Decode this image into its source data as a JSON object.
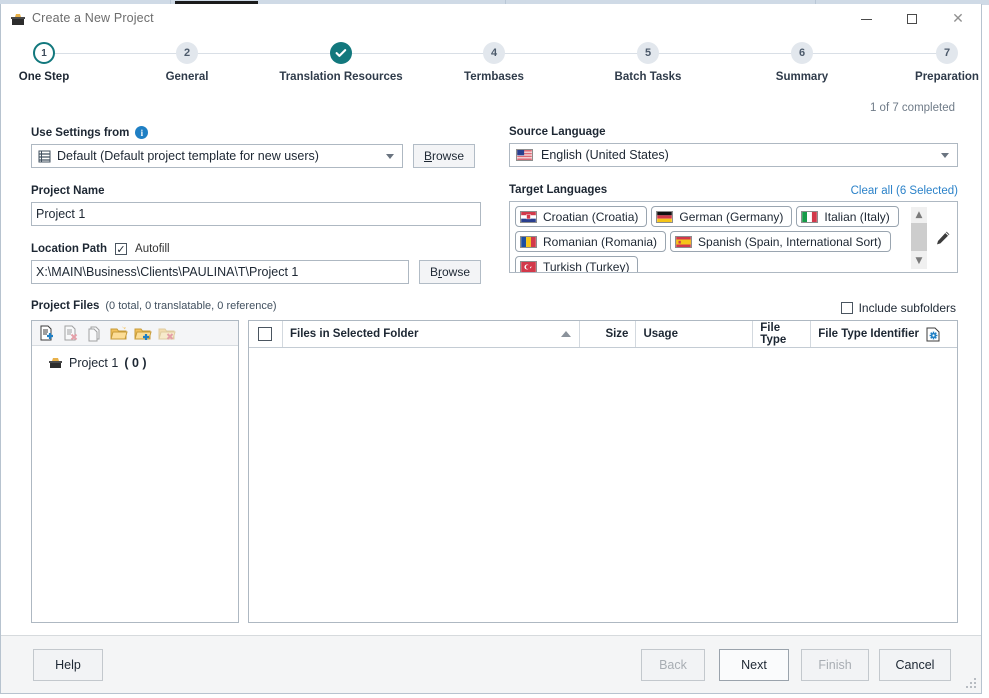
{
  "window": {
    "title": "Create a New Project",
    "icon": "project-box-icon",
    "controls": {
      "minimize": "Minimize",
      "maximize": "Maximize",
      "close": "Close"
    }
  },
  "stepper": {
    "completed_note": "1 of 7 completed",
    "steps": [
      {
        "num": "1",
        "label": "One Step",
        "state": "current"
      },
      {
        "num": "2",
        "label": "General",
        "state": "pending"
      },
      {
        "num": "3",
        "label": "Translation Resources",
        "state": "done"
      },
      {
        "num": "4",
        "label": "Termbases",
        "state": "pending"
      },
      {
        "num": "5",
        "label": "Batch Tasks",
        "state": "pending"
      },
      {
        "num": "6",
        "label": "Summary",
        "state": "pending"
      },
      {
        "num": "7",
        "label": "Preparation",
        "state": "pending"
      }
    ]
  },
  "form": {
    "use_settings": {
      "label": "Use Settings from",
      "info_glyph": "i",
      "value": "Default (Default project template for new users)",
      "browse": "Browse",
      "browse_accel": "B"
    },
    "project_name": {
      "label": "Project Name",
      "value": "Project 1",
      "placeholder": "Project Name"
    },
    "location_path": {
      "label": "Location Path",
      "autofill_label": "Autofill",
      "autofill_checked": true,
      "value": "X:\\MAIN\\Business\\Clients\\PAULINA\\T\\Project 1",
      "browse": "Browse",
      "browse_accel": "r"
    },
    "source_language": {
      "label": "Source Language",
      "value": "English (United States)",
      "flag": "flag-us"
    },
    "target_languages": {
      "label": "Target Languages",
      "clear_all": "Clear all (6 Selected)",
      "edit_icon": "pencil-icon",
      "items": [
        {
          "name": "Croatian (Croatia)",
          "flag": "flag-hr"
        },
        {
          "name": "German (Germany)",
          "flag": "flag-de"
        },
        {
          "name": "Italian (Italy)",
          "flag": "flag-it"
        },
        {
          "name": "Romanian (Romania)",
          "flag": "flag-ro"
        },
        {
          "name": "Spanish (Spain, International Sort)",
          "flag": "flag-es"
        },
        {
          "name": "Turkish (Turkey)",
          "flag": "flag-tr"
        }
      ]
    }
  },
  "project_files": {
    "label": "Project Files",
    "counts": "(0 total, 0 translatable, 0 reference)",
    "include_subfolders": {
      "label": "Include subfolders",
      "checked": false
    },
    "toolbar": [
      {
        "name": "add-file-icon",
        "enabled": true
      },
      {
        "name": "remove-file-icon",
        "enabled": false
      },
      {
        "name": "copy-file-icon",
        "enabled": false
      },
      {
        "name": "open-folder-icon",
        "enabled": true
      },
      {
        "name": "add-folder-icon",
        "enabled": true
      },
      {
        "name": "remove-folder-icon",
        "enabled": false
      }
    ],
    "tree": [
      {
        "label": "Project 1",
        "count": "( 0 )",
        "icon": "project-box-icon"
      }
    ],
    "grid": {
      "columns": [
        {
          "key": "select",
          "label": ""
        },
        {
          "key": "name",
          "label": "Files in Selected Folder",
          "sort": "asc"
        },
        {
          "key": "size",
          "label": "Size"
        },
        {
          "key": "usage",
          "label": "Usage"
        },
        {
          "key": "file_type",
          "label": "File Type"
        },
        {
          "key": "file_type_identifier",
          "label": "File Type Identifier"
        }
      ],
      "config_icon": "column-settings-icon",
      "rows": []
    }
  },
  "footer": {
    "help": "Help",
    "back": "Back",
    "next": "Next",
    "finish": "Finish",
    "cancel": "Cancel"
  },
  "colors": {
    "accent_teal": "#12787d",
    "link_blue": "#2b82c9",
    "border": "#aeb8c2"
  }
}
